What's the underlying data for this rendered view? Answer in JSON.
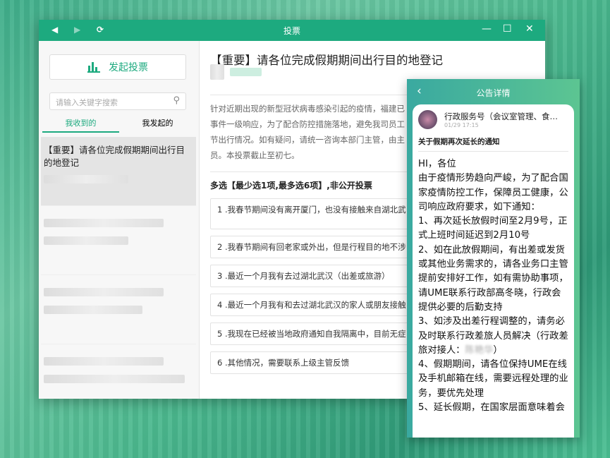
{
  "window": {
    "title": "投票",
    "back": "◀",
    "forward": "▶",
    "refresh": "⟳",
    "minimize": "—",
    "maximize": "☐",
    "close": "✕"
  },
  "sidebar": {
    "start_vote": "发起投票",
    "search_placeholder": "请输入关键字搜索",
    "tabs": [
      "我收到的",
      "我发起的"
    ],
    "items": [
      {
        "title": "【重要】请各位完成假期期间出行目的地登记"
      }
    ]
  },
  "main": {
    "title": "【重要】请各位完成假期期间出行目的地登记",
    "description": [
      "针对近期出现的新型冠状病毒感染引起的疫情，福建已",
      "事件一级响应，为了配合防控措施落地，避免我司员工",
      "节出行情况。如有疑问，请统一咨询本部门主管，由主",
      "员。本投票截止至初七。"
    ],
    "question_type": "多选【最少选1项,最多选6项】,非公开投票",
    "options": [
      "1 .我春节期间没有离开厦门，也没有接触来自湖北武",
      "2 .我春节期间有回老家或外出，但是行程目的地不涉",
      "3 .最近一个月我有去过湖北武汉（出差或旅游）",
      "4 .最近一个月我有和去过湖北武汉的家人或朋友接触",
      "5 .我现在已经被当地政府通知自我隔离中，目前无症",
      "6 .其他情况，需要联系上级主管反馈"
    ]
  },
  "notice": {
    "header": "公告详情",
    "sender": "行政服务号（会议室管理、食堂、...",
    "time": "01/29 17:15",
    "title": "关于假期再次延长的通知",
    "body_before": "HI，各位\n由于疫情形势趋向严峻，为了配合国家疫情防控工作，保障员工健康，公司响应政府要求，如下通知：\n1、再次延长放假时间至2月9号，正式上班时间延迟到2月10号\n2、如在此放假期间，有出差或发货或其他业务需求的，请各业务口主管提前安排好工作，如有需协助事项，请UME联系行政部高冬晓，行政会提供必要的后勤支持\n3、如涉及出差行程调整的，请务必及时联系行政差旅人员解决（行政差旅对接人：",
    "masked_name": "陈艳华",
    "body_after": "）\n4、假期期间，请各位保持UME在线及手机邮箱在线，需要远程处理的业务，要优先处理\n5、延长假期，在国家层面意味着会"
  }
}
